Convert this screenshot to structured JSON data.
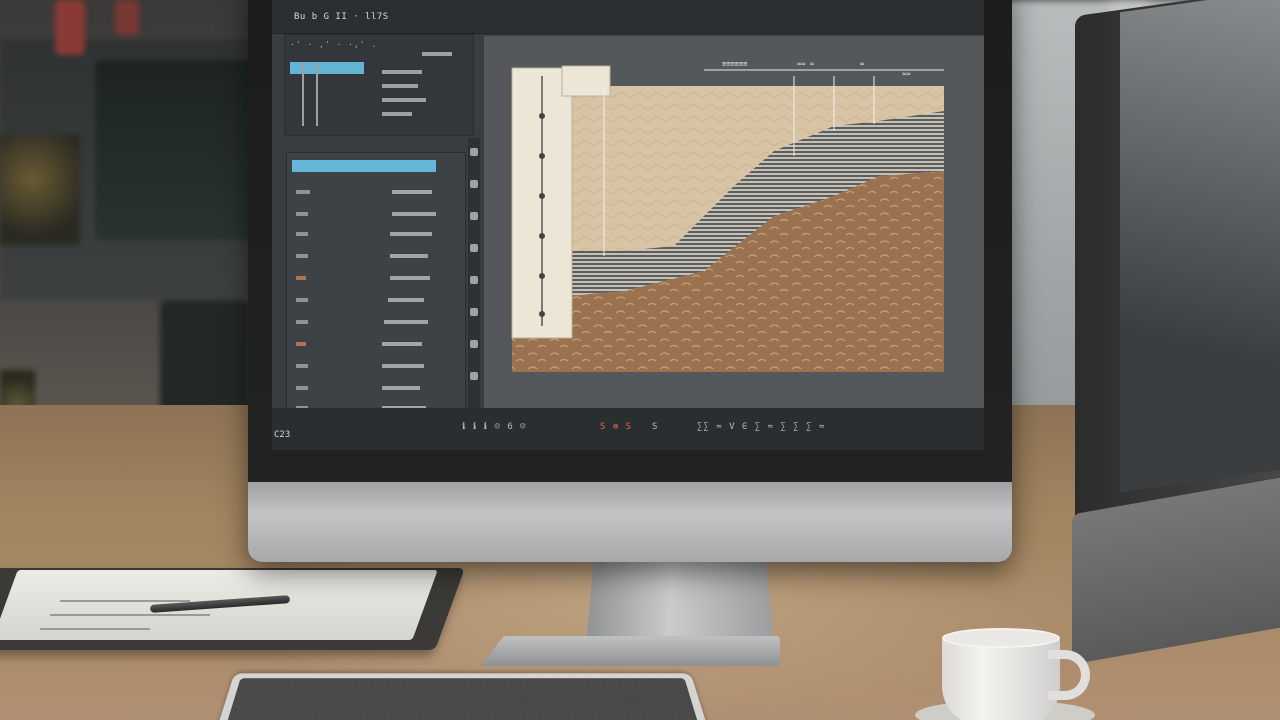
{
  "scene": {
    "description_title": "",
    "colors": {
      "accent_blue": "#64b4d6",
      "soil_brown": "#9a7250",
      "sand_beige": "#d8c4a4",
      "desk_wood": "#a2845f",
      "ui_dark": "#3a3d40"
    }
  },
  "app": {
    "window_title": "Bu b G II · ll7S",
    "toolbar_glyphs": "·' ·  ,' ·  ·,' .",
    "corner_label": "C23",
    "status_left": "ℹ ℹ ℹ ☺ 6 ☺",
    "status_mid_1": "S ⊚ S",
    "status_mid_2": "S",
    "status_right": "∑∑ ≈ V ∈ ∑ ≈ ∑ ∑ ∑ ≈",
    "dimension_labels": [
      "≡≡≡≡≡≡",
      "≈≈ ≈",
      "≈",
      "≈≈"
    ]
  },
  "icons": {
    "tools": [
      "tool-icon",
      "tool-icon",
      "tool-icon",
      "tool-icon",
      "tool-icon",
      "tool-icon",
      "tool-icon",
      "tool-icon"
    ]
  }
}
